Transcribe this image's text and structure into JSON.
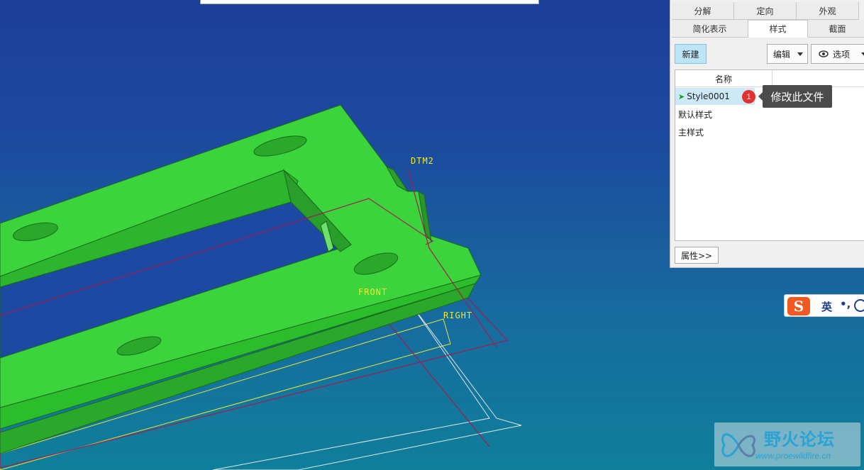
{
  "viewport": {
    "datum_labels": {
      "dtm2": "DTM2",
      "front": "FRONT",
      "right": "RIGHT"
    },
    "colors": {
      "part": "#33cc33",
      "datum_red": "#a01e50",
      "datum_yellow": "#e6e63a",
      "background_top": "#1c3f9a",
      "background_bottom": "#0f7f9a"
    }
  },
  "panel": {
    "tabs_row1": [
      "分解",
      "定向",
      "外观"
    ],
    "tabs_row2": [
      "简化表示",
      "样式",
      "截面"
    ],
    "active_tab": "样式",
    "toolbar": {
      "new_label": "新建",
      "edit_label": "编辑",
      "options_label": "选项"
    },
    "list": {
      "column_header": "名称",
      "items": [
        {
          "label": "Style0001",
          "selected": true,
          "icon": "arrow-right-icon"
        },
        {
          "label": "默认样式",
          "selected": false
        },
        {
          "label": "主样式",
          "selected": false
        }
      ]
    },
    "properties_label": "属性>>"
  },
  "callout": {
    "badge": "1",
    "text": "修改此文件"
  },
  "ime": {
    "logo": "S",
    "lang": "英",
    "punct": "•,",
    "icon": "smiley-icon"
  },
  "watermark": {
    "name": "野火论坛",
    "url": "www.proewildfire.cn"
  }
}
